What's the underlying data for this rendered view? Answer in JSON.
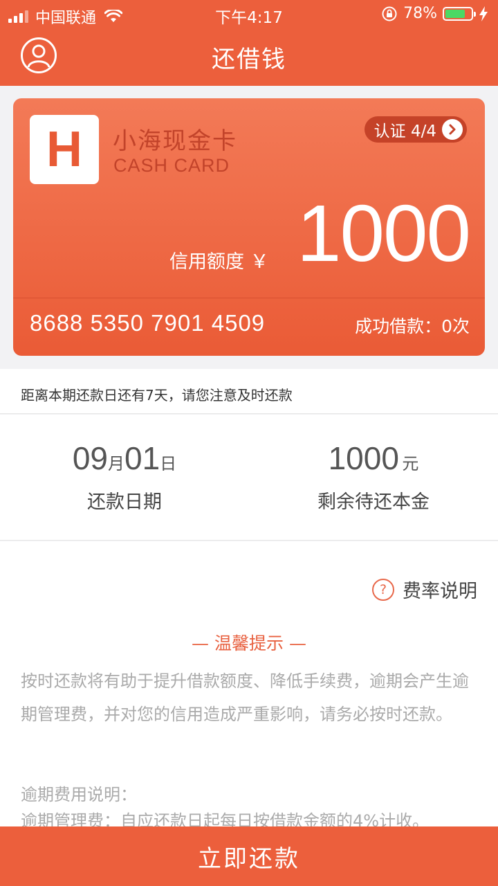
{
  "status_bar": {
    "carrier": "中国联通",
    "time": "下午4:17",
    "battery": "78%",
    "battery_level": 0.78
  },
  "header": {
    "title": "还借钱"
  },
  "card": {
    "logo_letter": "H",
    "name": "小海现金卡",
    "subtitle": "CASH CARD",
    "certification": "认证 4/4",
    "credit_label": "信用额度 ￥",
    "credit_amount": "1000",
    "card_number": "8688 5350 7901 4509",
    "success_count": "成功借款：0次"
  },
  "notice": {
    "text": "距离本期还款日还有7天，请您注意及时还款"
  },
  "stats": {
    "due_date": {
      "month": "09",
      "month_unit": "月",
      "day": "01",
      "day_unit": "日",
      "label": "还款日期"
    },
    "remaining": {
      "amount": "1000",
      "unit": "元",
      "label": "剩余待还本金"
    }
  },
  "content": {
    "rate_link": "费率说明",
    "help_symbol": "?",
    "tips_title": "— 温馨提示 —",
    "tips_text": "按时还款将有助于提升借款额度、降低手续费，逾期会产生逾期管理费，并对您的信用造成严重影响，请务必按时还款。",
    "overdue_title": "逾期费用说明：",
    "overdue_fee": "逾期管理费：自应还款日起每日按借款金额的4%计收。"
  },
  "action": {
    "repay_label": "立即还款"
  },
  "colors": {
    "brand": "#ec5f3c",
    "accent": "#e8603f",
    "battery": "#4cd964"
  },
  "icons": [
    "signal-icon",
    "wifi-icon",
    "rotation-lock-icon",
    "battery-icon",
    "charging-bolt-icon",
    "user-avatar-icon",
    "chevron-right-icon",
    "help-icon"
  ]
}
